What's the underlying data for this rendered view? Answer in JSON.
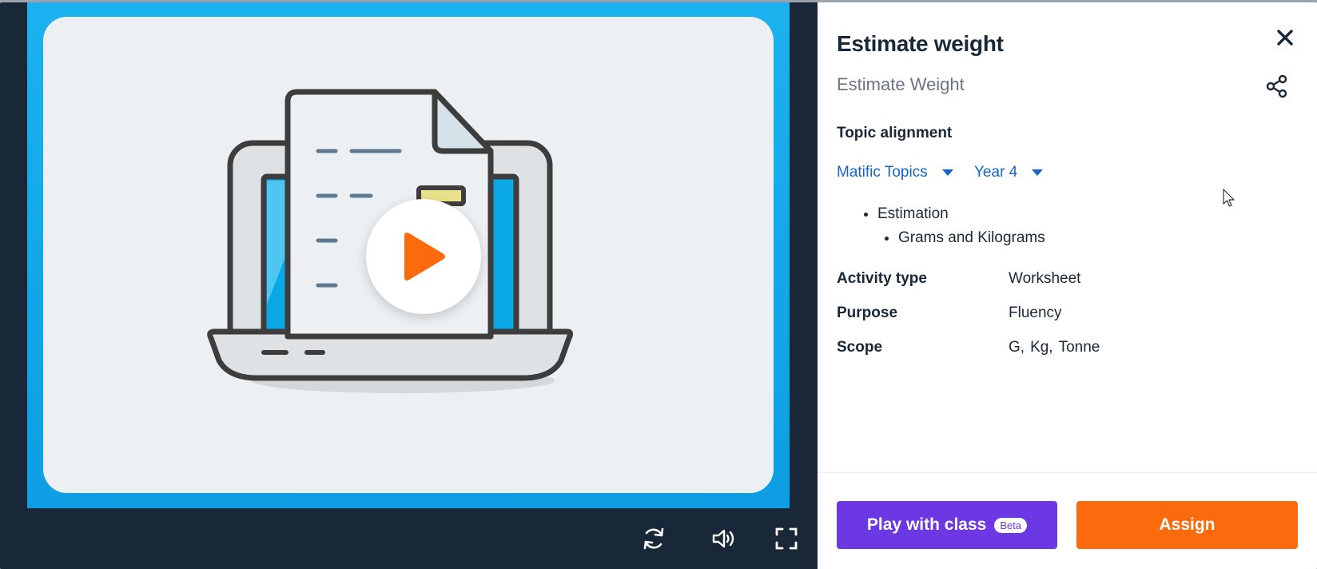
{
  "activity": {
    "title": "Estimate weight",
    "subtitle": "Estimate Weight"
  },
  "topic_alignment": {
    "label": "Topic alignment",
    "curriculum_dropdown": "Matific Topics",
    "year_dropdown": "Year 4",
    "topics": [
      {
        "label": "Estimation",
        "level": 1
      },
      {
        "label": "Grams and Kilograms",
        "level": 2
      }
    ]
  },
  "details": {
    "activity_type": {
      "label": "Activity type",
      "value": "Worksheet"
    },
    "purpose": {
      "label": "Purpose",
      "value": "Fluency"
    },
    "scope": {
      "label": "Scope",
      "values": [
        "G,",
        "Kg,",
        "Tonne"
      ]
    }
  },
  "buttons": {
    "play_with_class": "Play with class",
    "beta_badge": "Beta",
    "assign": "Assign"
  },
  "icons": {
    "close": "close-icon",
    "share": "share-icon",
    "play": "play-icon",
    "restart": "restart-icon",
    "volume": "volume-icon",
    "fullscreen": "fullscreen-icon"
  },
  "colors": {
    "stage_blue": "#1ab2ee",
    "dark_navy": "#192838",
    "link_blue": "#1564c6",
    "purple": "#6c38e3",
    "orange": "#fb6b0d"
  }
}
